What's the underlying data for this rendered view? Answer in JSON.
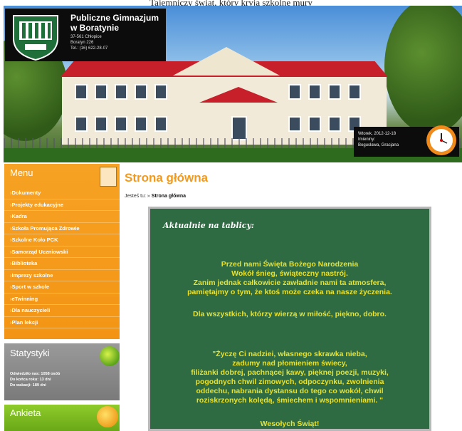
{
  "top_caption": "Tajemniczy świat, który kryją szkolne mury",
  "header": {
    "school_name": "Publiczne Gimnazjum w Boratynie",
    "address": [
      "37-561 Chłopice",
      "Boratyn 226",
      "Tel.: (16) 622-28-07"
    ],
    "crest_text": "Gimnazjum w Boratynie",
    "date": "Wtorek, 2012-12-18",
    "name_day_label": "Imieniny:",
    "name_day_names": "Bogusława, Gracjana"
  },
  "sidebar": {
    "menu_title": "Menu",
    "menu_items": [
      "Dokumenty",
      "Projekty edukacyjne",
      "Kadra",
      "Szkoła Promująca Zdrowie",
      "Szkolne Koło PCK",
      "Samorząd Uczniowski",
      "Biblioteka",
      "Imprezy szkolne",
      "Sport w szkole",
      "eTwinning",
      "Dla nauczycieli",
      "Plan lekcji"
    ],
    "stats_title": "Statystyki",
    "stats": [
      {
        "label": "Odwiedziło nas:",
        "value": "1058 osób"
      },
      {
        "label": "Do końca roku:",
        "value": "13 dni"
      },
      {
        "label": "Do wakacji:",
        "value": "189 dni"
      }
    ],
    "poll_title": "Ankieta"
  },
  "main": {
    "title": "Strona główna",
    "breadcrumb_prefix": "Jesteś tu:",
    "breadcrumb_sep": "»",
    "breadcrumb_current": "Strona główna",
    "board_heading": "Aktualnie na tablicy:",
    "paragraph1": [
      "Przed nami Święta Bożego Narodzenia",
      "Wokół śnieg, świąteczny nastrój.",
      "Zanim jednak całkowicie zawładnie nami ta atmosfera,",
      "pamiętajmy o tym, że ktoś może czeka na nasze życzenia."
    ],
    "paragraph2": "Dla wszystkich, którzy wierzą w miłość, piękno, dobro.",
    "paragraph3": [
      "\"Życzę Ci nadziei, własnego skrawka nieba,",
      "zadumy nad płomieniem świecy,",
      "filiżanki dobrej, pachnącej kawy, pięknej poezji, muzyki,",
      "pogodnych chwil zimowych, odpoczynku, zwolnienia",
      "oddechu, nabrania dystansu do tego co wokół, chwil",
      "roziskrzonych kolędą, śmiechem i wspomnieniami. \""
    ],
    "closing": "Wesołych Świąt!"
  },
  "colors": {
    "menu_orange": "#f39414",
    "title_orange": "#f39a1c",
    "board_green": "#2f6b42",
    "board_text": "#e9e12a"
  }
}
